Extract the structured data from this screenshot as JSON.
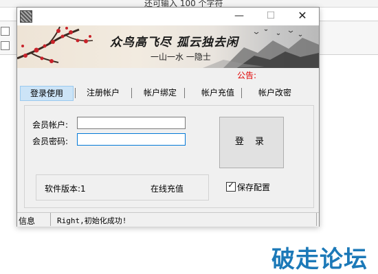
{
  "background": {
    "top_text": "还可输入 100 个字符",
    "watermark": "破走论坛"
  },
  "window": {
    "controls": {
      "minimize": "—",
      "maximize": "☐",
      "close": "✕"
    },
    "banner": {
      "title": "众鸟高飞尽  孤云独去闲",
      "subtitle": "一山一水 一隐士"
    },
    "notice_label": "公告:",
    "tabs": [
      {
        "label": "登录使用",
        "selected": true
      },
      {
        "label": "注册帐户"
      },
      {
        "label": "帐户绑定"
      },
      {
        "label": "帐户充值"
      },
      {
        "label": "帐户改密"
      }
    ],
    "login": {
      "account_label": "会员帐户:",
      "account_value": "",
      "password_label": "会员密码:",
      "password_value": "",
      "login_button": "登录",
      "version_label": "软件版本:1",
      "recharge_link": "在线充值",
      "save_config_label": "保存配置",
      "save_config_checked": true
    },
    "status": {
      "label": "信息",
      "message": "Right,初始化成功!"
    }
  }
}
